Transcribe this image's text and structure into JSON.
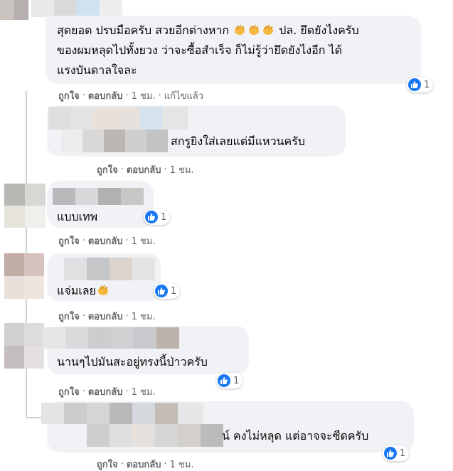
{
  "comments": [
    {
      "text_lines": [
        "สุดยอด ปรบมือครับ สวยอีกต่างหาก",
        "ของผมหลุดไปทั้งยวง ว่าจะซื้อสำเร็จ ก็ไม่รู้ว่ายึดยังไงอีก ได้",
        "แรงบันดาลใจละ"
      ],
      "text_suffix": "ปล. ยึดยังไงครับ",
      "like_label": "ถูกใจ",
      "reply_label": "ตอบกลับ",
      "time": "1 ชม.",
      "edit_label": "แก้ไขแล้ว",
      "reaction_count": "1"
    },
    {
      "text": "สกรูยิงใส่เลยแต่มีแหวนครับ",
      "like_label": "ถูกใจ",
      "reply_label": "ตอบกลับ",
      "time": "1 ชม."
    },
    {
      "text": "แบบเทพ",
      "like_label": "ถูกใจ",
      "reply_label": "ตอบกลับ",
      "time": "1 ชม.",
      "reaction_count": "1"
    },
    {
      "text": "แจ่มเลย",
      "like_label": "ถูกใจ",
      "reply_label": "ตอบกลับ",
      "time": "1 ชม.",
      "reaction_count": "1"
    },
    {
      "text": "นานๆไปมันสะอยู่ทรงนี้ป่าวครับ",
      "like_label": "ถูกใจ",
      "reply_label": "ตอบกลับ",
      "time": "1 ชม.",
      "reaction_count": "1"
    },
    {
      "text": "น์ คงไม่หลุด แต่อาจจะซีดครับ",
      "like_label": "ถูกใจ",
      "reply_label": "ตอบกลับ",
      "time": "1 ชม.",
      "reaction_count": "1"
    }
  ],
  "colors": {
    "bubble": "#f0f2f5",
    "meta_text": "#65676b",
    "like_blue": "#1877f2",
    "thread_line": "#ced0d4"
  },
  "icons": {
    "reaction": "thumbs-up-icon",
    "emoji": "clapping-hands-icon"
  }
}
